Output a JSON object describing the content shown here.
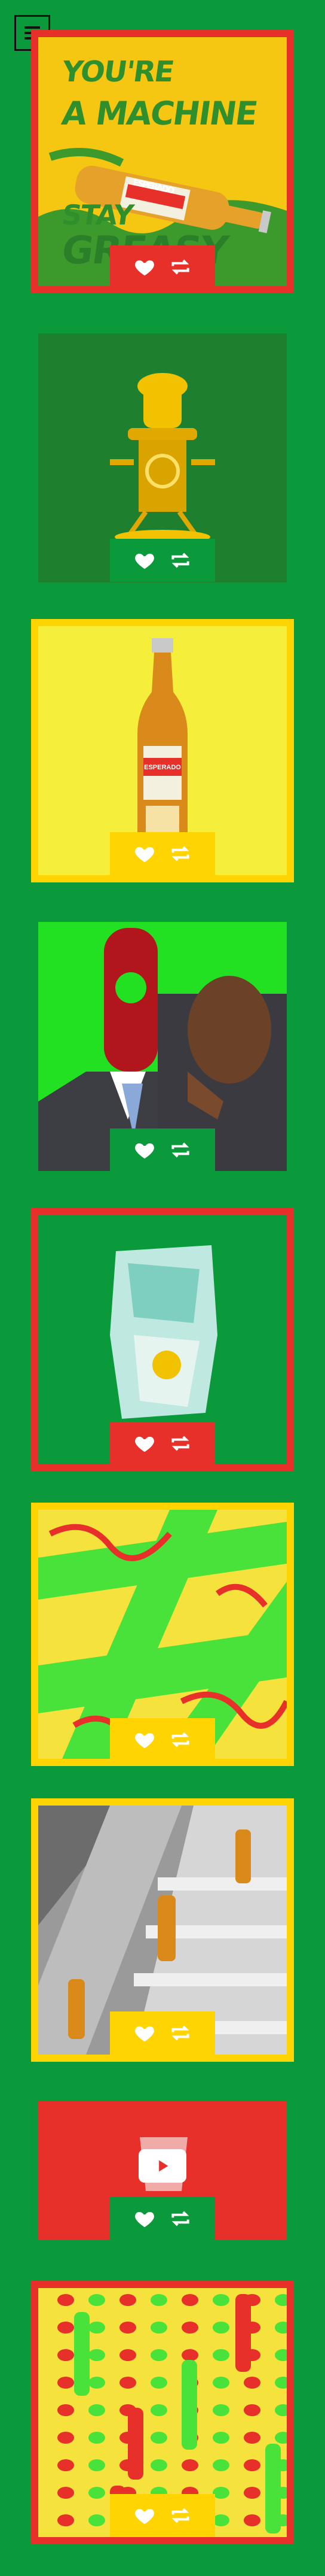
{
  "menu": {
    "icon": "hamburger-menu-icon"
  },
  "colors": {
    "page_bg": "#0a9a3c",
    "red": "#e8302b",
    "yellow": "#ffd400",
    "green": "#0a9a3c",
    "lime": "#2ee82e"
  },
  "hero": {
    "line1": "YOU'RE",
    "line2": "A MACHINE",
    "line3": "STAY",
    "line4": "GREASY",
    "bottle_label": "ESPERADO"
  },
  "cards": [
    {
      "id": "card-machine-stay-greasy",
      "icons": [
        "heart-icon",
        "retweet-icon"
      ]
    },
    {
      "id": "card-golden-trophy-robot",
      "icons": [
        "heart-icon",
        "retweet-icon"
      ]
    },
    {
      "id": "card-bottle-yellow",
      "icons": [
        "heart-icon",
        "retweet-icon"
      ],
      "bottle_label": "ESPERADO"
    },
    {
      "id": "card-opener-head",
      "icons": [
        "heart-icon",
        "retweet-icon"
      ]
    },
    {
      "id": "card-crumpled-foil",
      "icons": [
        "heart-icon",
        "retweet-icon"
      ]
    },
    {
      "id": "card-abstract-pattern",
      "icons": [
        "heart-icon",
        "retweet-icon"
      ]
    },
    {
      "id": "card-escalator-bottles",
      "icons": [
        "heart-icon",
        "retweet-icon"
      ]
    },
    {
      "id": "card-video",
      "icons": [
        "heart-icon",
        "retweet-icon",
        "play-icon"
      ]
    },
    {
      "id": "card-polka-pattern",
      "icons": [
        "heart-icon",
        "retweet-icon"
      ]
    }
  ]
}
